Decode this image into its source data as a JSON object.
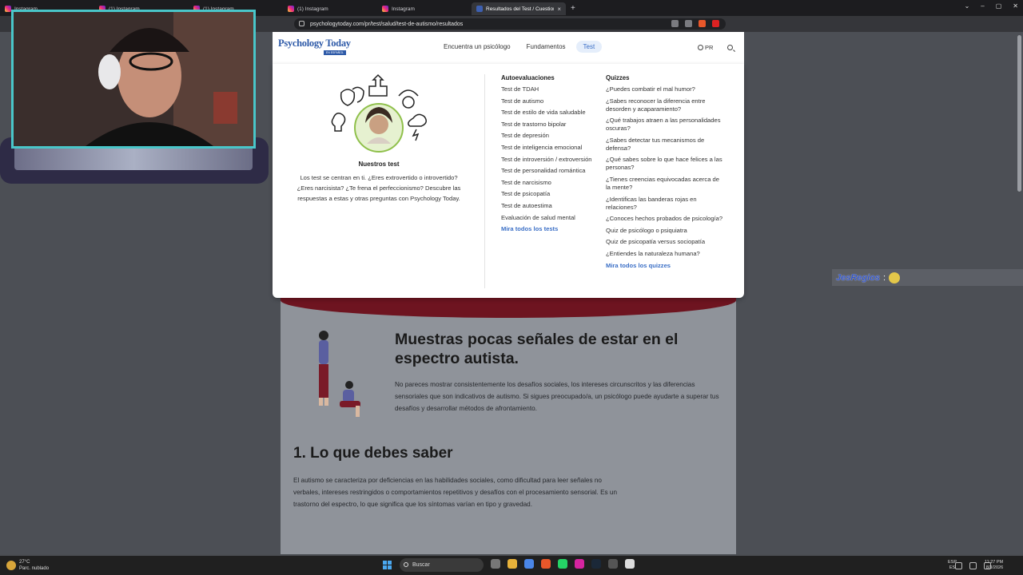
{
  "browser": {
    "tabs": [
      {
        "label": "Instagram",
        "icon": "instagram-icon",
        "active": false
      },
      {
        "label": "(1) Instagram",
        "icon": "instagram-icon",
        "active": false
      },
      {
        "label": "(1) Instagram",
        "icon": "instagram-icon",
        "active": false
      },
      {
        "label": "(1) Instagram",
        "icon": "instagram-icon",
        "active": false
      },
      {
        "label": "Instagram",
        "icon": "instagram-icon",
        "active": false
      },
      {
        "label": "Resultados del Test / Cuestiona",
        "icon": "psychology-today-icon",
        "active": true
      }
    ],
    "url": "psychologytoday.com/pr/test/salud/test-de-autismo/resultados",
    "brand_color": "#2e5aa8"
  },
  "site": {
    "logo_text": "Psychology Today",
    "logo_sub": "EN ESPAÑOL",
    "nav": [
      "Encuentra un psicólogo",
      "Fundamentos",
      "Test"
    ],
    "lang": "PR"
  },
  "mega": {
    "tests_title": "Nuestros test",
    "tests_desc": "Los test se centran en ti. ¿Eres extrovertido o introvertido? ¿Eres narcisista? ¿Te frena el perfeccionismo? Descubre las respuestas a estas y otras preguntas con Psychology Today.",
    "self_eval": {
      "heading": "Autoevaluaciones",
      "items": [
        "Test de TDAH",
        "Test de autismo",
        "Test de estilo de vida saludable",
        "Test de trastorno bipolar",
        "Test de depresión",
        "Test de inteligencia emocional",
        "Test de introversión / extroversión",
        "Test de personalidad romántica",
        "Test de narcisismo",
        "Test de psicopatía",
        "Test de autoestima",
        "Evaluación de salud mental"
      ],
      "more": "Mira todos los tests"
    },
    "quizzes": {
      "heading": "Quizzes",
      "items": [
        "¿Puedes combatir el mal humor?",
        "¿Sabes reconocer la diferencia entre desorden y acaparamiento?",
        "¿Qué trabajos atraen a las personalidades oscuras?",
        "¿Sabes detectar tus mecanismos de defensa?",
        "¿Qué sabes sobre lo que hace felices a las personas?",
        "¿Tienes creencias equivocadas acerca de la mente?",
        "¿Identificas las banderas rojas en relaciones?",
        "¿Conoces hechos probados de psicología?",
        "Quiz de psicólogo o psiquiatra",
        "Quiz de psicopatía versus sociopatía",
        "¿Entiendes la naturaleza humana?"
      ],
      "more": "Mira todos los quizzes"
    }
  },
  "result": {
    "title": "Muestras pocas señales de estar en el espectro autista.",
    "desc": "No pareces mostrar consistentemente los desafíos sociales, los intereses circunscritos y las diferencias sensoriales que son indicativos de autismo. Si sigues preocupado/a, un psicólogo puede ayudarte a superar tus desafíos y desarrollar métodos de afrontamiento.",
    "section_title": "1. Lo que debes saber",
    "section_text": "El autismo se caracteriza por deficiencias en las habilidades sociales, como dificultad para leer señales no verbales, intereses restringidos o comportamientos repetitivos y desafíos con el procesamiento sensorial. Es un trastorno del espectro, lo que significa que los síntomas varían en tipo y gravedad."
  },
  "chat": {
    "name": "JesRegios",
    "sep": ":"
  },
  "taskbar": {
    "weather_temp": "27°C",
    "weather_desc": "Parc. nublado",
    "search": "Buscar",
    "lang1": "ESP",
    "lang2": "ES",
    "time": "11:27 PM",
    "date": "8/3/2026"
  }
}
